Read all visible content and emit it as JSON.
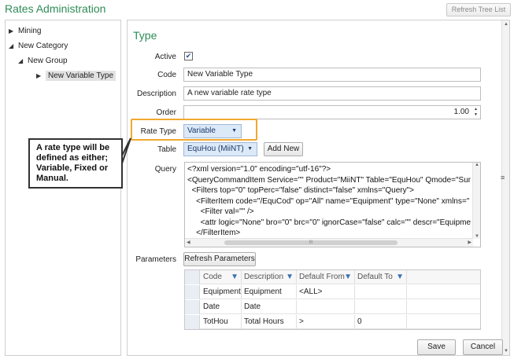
{
  "app": {
    "title": "Rates Administration",
    "refresh_tree_label": "Refresh Tree List"
  },
  "tree": {
    "items": [
      {
        "label": "Mining",
        "arrow": "▶"
      },
      {
        "label": "New Category",
        "arrow": "◢"
      },
      {
        "label": "New Group",
        "arrow": "◢"
      },
      {
        "label": "New Variable Type",
        "arrow": "▶"
      }
    ]
  },
  "form": {
    "heading": "Type",
    "active_label": "Active",
    "active_checked": true,
    "code_label": "Code",
    "code_value": "New Variable Type",
    "description_label": "Description",
    "description_value": "A new variable rate type",
    "order_label": "Order",
    "order_value": "1.00",
    "rate_type_label": "Rate Type",
    "rate_type_value": "Variable",
    "table_label": "Table",
    "table_value": "EquHou (MiiNT)",
    "add_new_label": "Add New",
    "query_label": "Query",
    "query_lines": [
      "<?xml version=\"1.0\" encoding=\"utf-16\"?>",
      "<QueryCommandItem Service=\"\" Product=\"MiiNT\" Table=\"EquHou\" Qmode=\"Sum",
      "  <Filters top=\"0\" topPerc=\"false\" distinct=\"false\" xmlns=\"Query\">",
      "    <FilterItem code=\"/EquCod\" op=\"All\" name=\"Equipment\" type=\"None\" xmlns=\"",
      "      <Filter val=\"\" />",
      "      <attr logic=\"None\" bro=\"0\" brc=\"0\" ignorCase=\"false\" calc=\"\" descr=\"Equipme",
      "    </FilterItem>"
    ],
    "query_hscroll_thumb": "III",
    "parameters_label": "Parameters",
    "refresh_parameters_label": "Refresh Parameters"
  },
  "params_table": {
    "columns": [
      "Code",
      "Description",
      "Default From",
      "Default To"
    ],
    "rows": [
      [
        "Equipment",
        "Equipment",
        "<ALL>",
        ""
      ],
      [
        "Date",
        "Date",
        "",
        ""
      ],
      [
        "TotHou",
        "Total Hours",
        ">",
        "0"
      ]
    ]
  },
  "callout": {
    "text": "A rate type will be defined as either; Variable, Fixed or Manual."
  },
  "buttons": {
    "save_label": "Save",
    "cancel_label": "Cancel"
  },
  "colors": {
    "heading_green": "#2e8b57",
    "highlight_orange": "#f0a830",
    "dropdown_blue": "#dce9f8"
  }
}
